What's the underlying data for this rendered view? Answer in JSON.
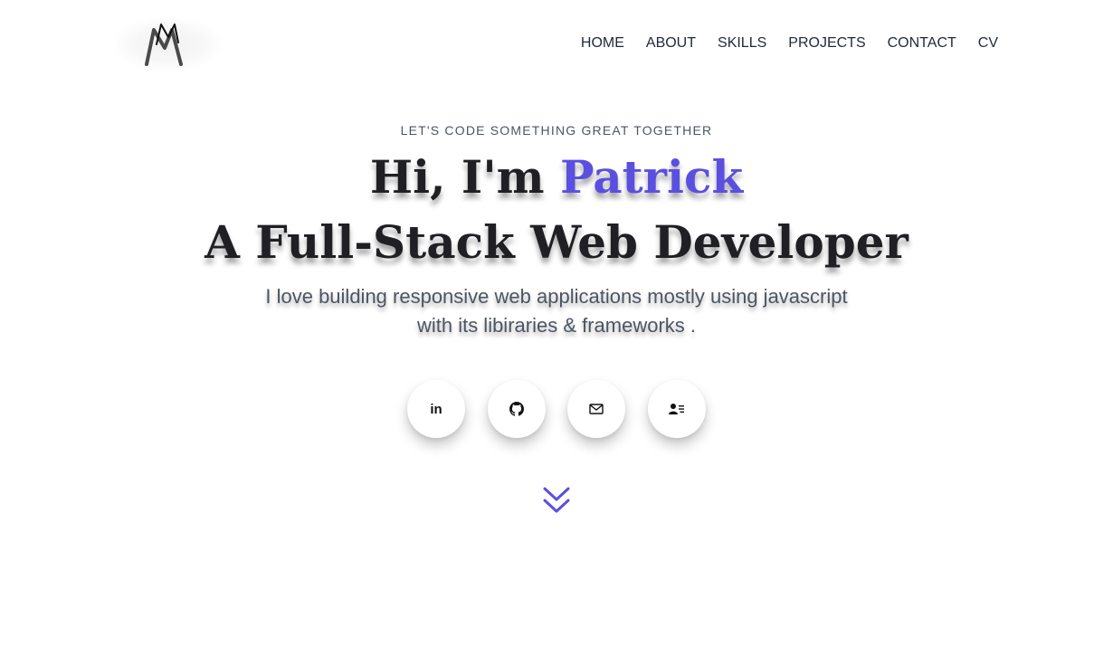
{
  "logo": {
    "icon": "m-logo-icon"
  },
  "nav": {
    "items": [
      {
        "label": "HOME"
      },
      {
        "label": "ABOUT"
      },
      {
        "label": "SKILLS"
      },
      {
        "label": "PROJECTS"
      },
      {
        "label": "CONTACT"
      },
      {
        "label": "CV"
      }
    ]
  },
  "hero": {
    "tagline": "LET'S CODE SOMETHING GREAT TOGETHER",
    "greeting": "Hi, I'm ",
    "name": "Patrick",
    "title": "A Full-Stack Web Developer",
    "description_line1": "I love building responsive web applications mostly using javascript",
    "description_line2": "with its libiraries & frameworks ."
  },
  "socials": [
    {
      "icon": "linkedin-icon",
      "text": "in"
    },
    {
      "icon": "github-icon"
    },
    {
      "icon": "mail-icon"
    },
    {
      "icon": "contact-card-icon"
    }
  ],
  "colors": {
    "accent": "#5b4fe0",
    "text": "#1f1f24",
    "muted": "#4b5563"
  },
  "scroll_icon": "double-chevron-down-icon"
}
